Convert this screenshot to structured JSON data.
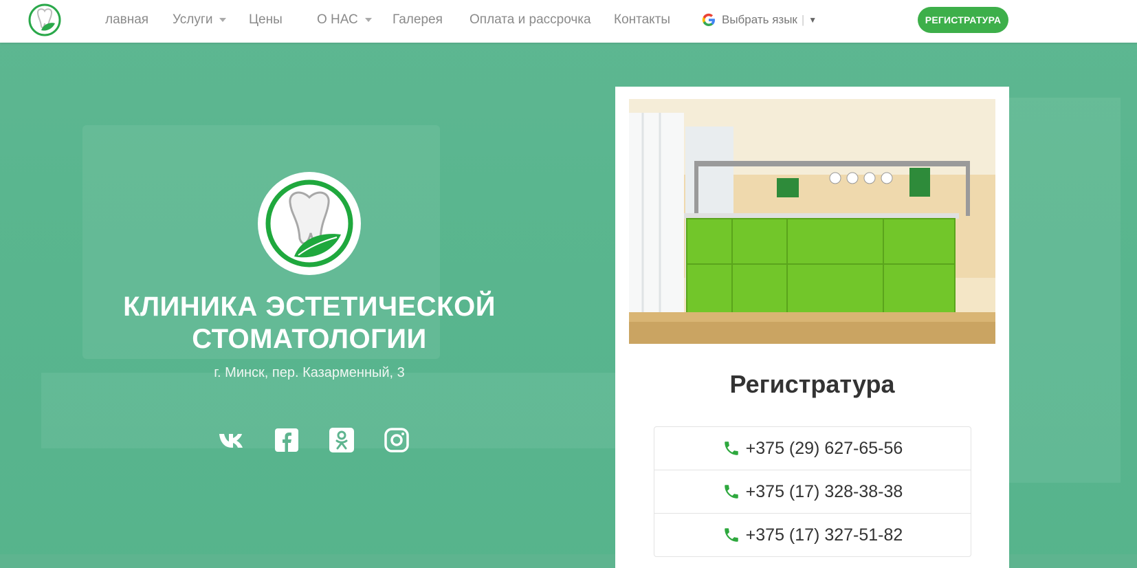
{
  "nav": {
    "items": [
      {
        "label": "лавная"
      },
      {
        "label": "Услуги"
      },
      {
        "label": "Цены"
      },
      {
        "label": "О НАС"
      },
      {
        "label": "Галерея"
      },
      {
        "label": "Оплата и рассрочка"
      },
      {
        "label": "Контакты"
      }
    ],
    "language": {
      "label": "Выбрать язык"
    },
    "register_button": "РЕГИСТРАТУРА"
  },
  "hero": {
    "title_line1": "КЛИНИКА ЭСТЕТИЧЕСКОЙ",
    "title_line2": "СТОМАТОЛОГИИ",
    "address": "г. Минск, пер. Казарменный, 3",
    "socials": [
      "vk-icon",
      "facebook-icon",
      "odnoklassniki-icon",
      "instagram-icon"
    ]
  },
  "card": {
    "title": "Регистратура",
    "phones": [
      "+375 (29) 627-65-56",
      "+375 (17) 328-38-38",
      "+375 (17) 327-51-82"
    ]
  },
  "colors": {
    "brand_green": "#3daf4a",
    "hero_overlay": "#54b48c",
    "text_dark": "#333333"
  }
}
